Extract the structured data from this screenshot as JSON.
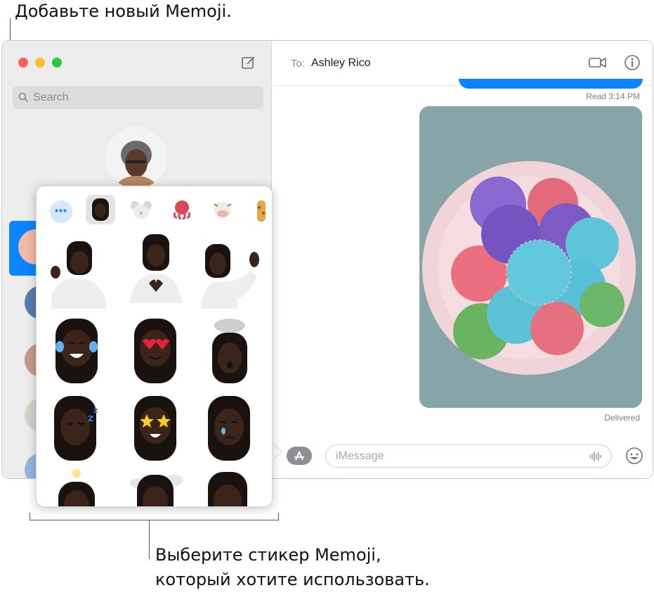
{
  "callouts": {
    "top": "Добавьте новый Memoji.",
    "bottom_line1": "Выберите стикер Memoji,",
    "bottom_line2": "который хотите использовать."
  },
  "sidebar": {
    "search_placeholder": "Search"
  },
  "conversation": {
    "to_label": "To:",
    "recipient": "Ashley Rico",
    "read_status": "Read 3:14 PM",
    "delivered_status": "Delivered",
    "input_placeholder": "iMessage"
  },
  "sticker_picker": {
    "tabs": [
      "more-icon",
      "memoji-icon",
      "mouse-icon",
      "octopus-icon",
      "cow-icon",
      "giraffe-icon"
    ],
    "stickers": [
      "thumbs-pose",
      "heart-hands",
      "waving",
      "laugh-tears",
      "heart-eyes",
      "mind-blown",
      "sleeping",
      "star-struck",
      "crying",
      "idea",
      "cloud-head",
      "coughing"
    ]
  },
  "colors": {
    "accent": "#0a84ff",
    "sidebar_bg": "#ececec"
  }
}
